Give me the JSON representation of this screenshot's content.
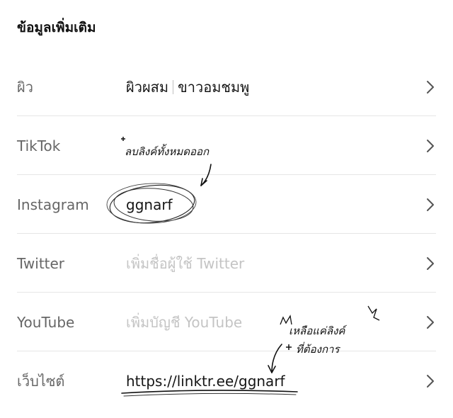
{
  "section": {
    "title": "ข้อมูลเพิ่มเติม"
  },
  "rows": [
    {
      "label": "ผิว",
      "value_a": "ผิวผสม",
      "value_b": "ขาวอมชมพู"
    },
    {
      "label": "TikTok",
      "value": ""
    },
    {
      "label": "Instagram",
      "value": "ggnarf"
    },
    {
      "label": "Twitter",
      "placeholder": "เพิ่มชื่อผู้ใช้ Twitter"
    },
    {
      "label": "YouTube",
      "placeholder": "เพิ่มบัญชี YouTube"
    },
    {
      "label": "เว็บไซต์",
      "value": "https://linktr.ee/ggnarf"
    }
  ],
  "annotations": {
    "tiktok_note": "ลบลิงค์ทั้งหมดออก",
    "website_note_line1": "เหลือแค่ลิงค์",
    "website_note_line2": "ที่ต้องการ"
  },
  "icons": {
    "chevron": "chevron-right-icon"
  }
}
